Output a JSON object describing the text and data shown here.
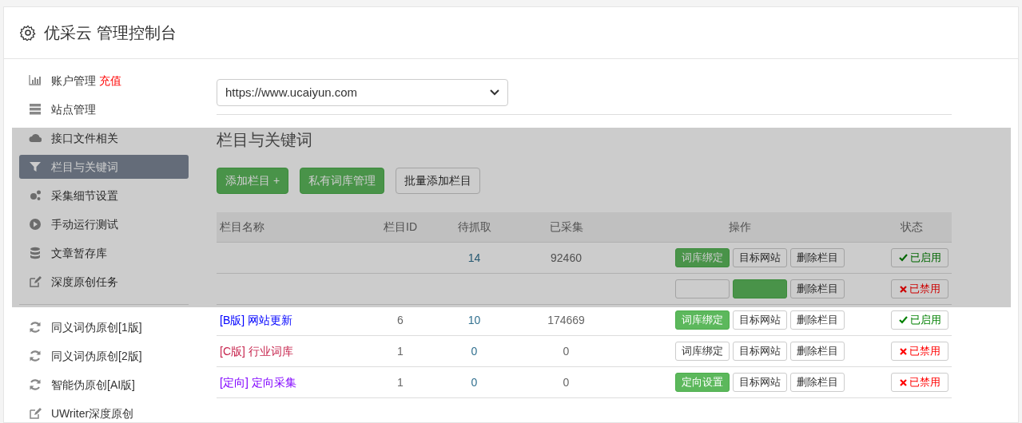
{
  "header": {
    "title": "优采云 管理控制台"
  },
  "sidebar": {
    "groups": [
      [
        {
          "label": "账户管理",
          "badge": "充值",
          "selected": false
        },
        {
          "label": "站点管理",
          "selected": false
        },
        {
          "label": "接口文件相关",
          "selected": false
        },
        {
          "label": "栏目与关键词",
          "selected": true
        },
        {
          "label": "采集细节设置",
          "selected": false
        },
        {
          "label": "手动运行测试",
          "selected": false
        },
        {
          "label": "文章暂存库",
          "selected": false
        },
        {
          "label": "深度原创任务",
          "selected": false
        }
      ],
      [
        {
          "label": "同义词伪原创[1版]",
          "selected": false
        },
        {
          "label": "同义词伪原创[2版]",
          "selected": false
        },
        {
          "label": "智能伪原创[AI版]",
          "selected": false
        },
        {
          "label": "UWriter深度原创",
          "selected": false
        }
      ]
    ]
  },
  "site_select": {
    "value": "https://www.ucaiyun.com"
  },
  "section_title": "栏目与关键词",
  "toolbar": [
    {
      "label": "添加栏目 +",
      "kind": "primary"
    },
    {
      "label": "私有词库管理",
      "kind": "primary"
    },
    {
      "label": "批量添加栏目",
      "kind": "default"
    }
  ],
  "table": {
    "columns": [
      "栏目名称",
      "栏目ID",
      "待抓取",
      "已采集",
      "操作",
      "状态"
    ],
    "rows": [
      {
        "pending": "14",
        "collected": "92460",
        "actions": [
          {
            "label": "词库绑定",
            "kind": "primary"
          },
          {
            "label": "目标网站",
            "kind": "default"
          },
          {
            "label": "删除栏目",
            "kind": "default"
          }
        ],
        "status": {
          "label": "已启用",
          "on": true
        }
      },
      {
        "actions": [
          {
            "kind": "default"
          },
          {
            "kind": "primary"
          },
          {
            "label": "删除栏目",
            "kind": "default"
          }
        ],
        "status": {
          "label": "已禁用",
          "on": false
        }
      },
      {
        "name": "[B版] 网站更新",
        "color": "#0000ff",
        "id": "6",
        "pending": "10",
        "collected": "174669",
        "actions": [
          {
            "label": "词库绑定",
            "kind": "primary"
          },
          {
            "label": "目标网站",
            "kind": "default"
          },
          {
            "label": "删除栏目",
            "kind": "default"
          }
        ],
        "status": {
          "label": "已启用",
          "on": true
        }
      },
      {
        "name": "[C版] 行业词库",
        "color": "#c7254e",
        "id": "1",
        "pending": "0",
        "collected": "0",
        "actions": [
          {
            "label": "词库绑定",
            "kind": "default"
          },
          {
            "label": "目标网站",
            "kind": "default"
          },
          {
            "label": "删除栏目",
            "kind": "default"
          }
        ],
        "status": {
          "label": "已禁用",
          "on": false
        }
      },
      {
        "name": "[定向] 定向采集",
        "color": "#8000ff",
        "id": "1",
        "pending": "0",
        "collected": "0",
        "actions": [
          {
            "label": "定向设置",
            "kind": "primary"
          },
          {
            "label": "目标网站",
            "kind": "default"
          },
          {
            "label": "删除栏目",
            "kind": "default"
          }
        ],
        "status": {
          "label": "已禁用",
          "on": false
        }
      }
    ]
  }
}
